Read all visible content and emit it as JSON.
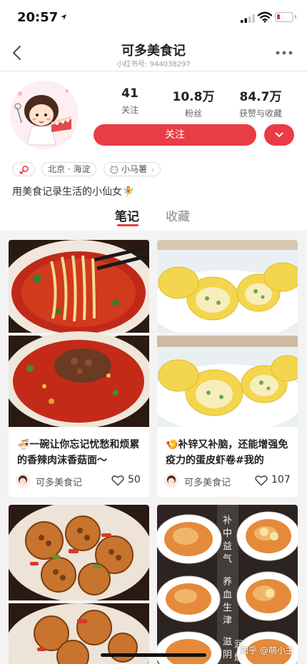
{
  "status_bar": {
    "time": "20:57"
  },
  "nav": {
    "title": "可多美食记",
    "subtitle": "小红书号: 944038297"
  },
  "profile": {
    "stats": [
      {
        "value": "41",
        "label": "关注"
      },
      {
        "value": "10.8万",
        "label": "粉丝"
      },
      {
        "value": "84.7万",
        "label": "获赞与收藏"
      }
    ],
    "follow_label": "关注",
    "tags": {
      "location": "北京 · 海淀",
      "level": "小马薯"
    },
    "bio": "用美食记录生活的小仙女🧚"
  },
  "tabs": {
    "notes": "笔记",
    "collections": "收藏"
  },
  "feed": [
    {
      "title": "🍜一碗让你忘记忧愁和烦累的香辣肉沫香菇面～",
      "author": "可多美食记",
      "likes": "50"
    },
    {
      "title": "🍤补锌又补脑，还能增强免疫力的蛋皮虾卷#我的",
      "author": "可多美食记",
      "likes": "107"
    }
  ],
  "watermark": "知乎 @萌小主",
  "colors": {
    "accent": "#ea3c45",
    "background": "#f3f3f3"
  }
}
